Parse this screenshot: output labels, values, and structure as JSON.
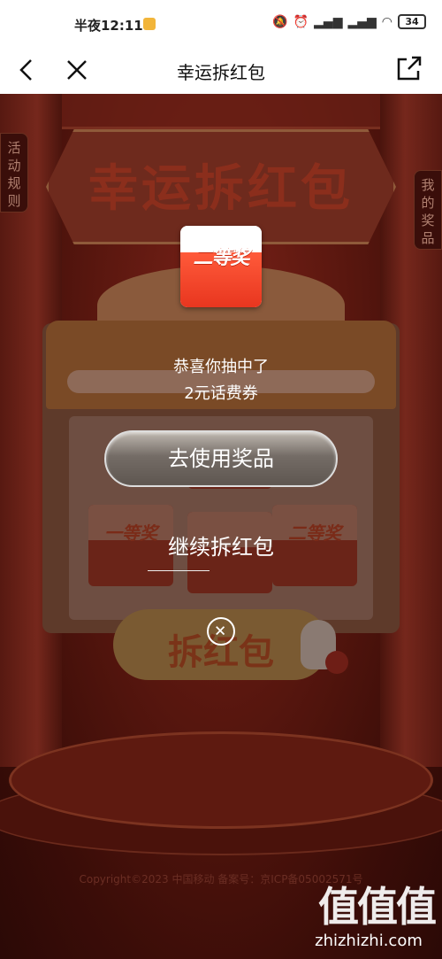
{
  "status_bar": {
    "time": "半夜12:11",
    "battery": "34"
  },
  "nav": {
    "title": "幸运拆红包"
  },
  "scene": {
    "banner_title": "幸运拆红包",
    "left_tab": "活动规则",
    "right_tab": "我的奖品",
    "open_button": "拆红包",
    "mini_cards": [
      "一等奖",
      "",
      "二等奖"
    ]
  },
  "modal": {
    "prize_label": "二等奖",
    "congrats": "恭喜你抽中了",
    "prize_desc": "2元话费券",
    "use_button": "去使用奖品",
    "continue_link": "继续拆红包"
  },
  "footer": {
    "copyright": "Copyright©2023 中国移动 备案号：京ICP备05002571号"
  },
  "watermark": {
    "brand": "值值值",
    "domain": "zhizhizhi.com"
  }
}
